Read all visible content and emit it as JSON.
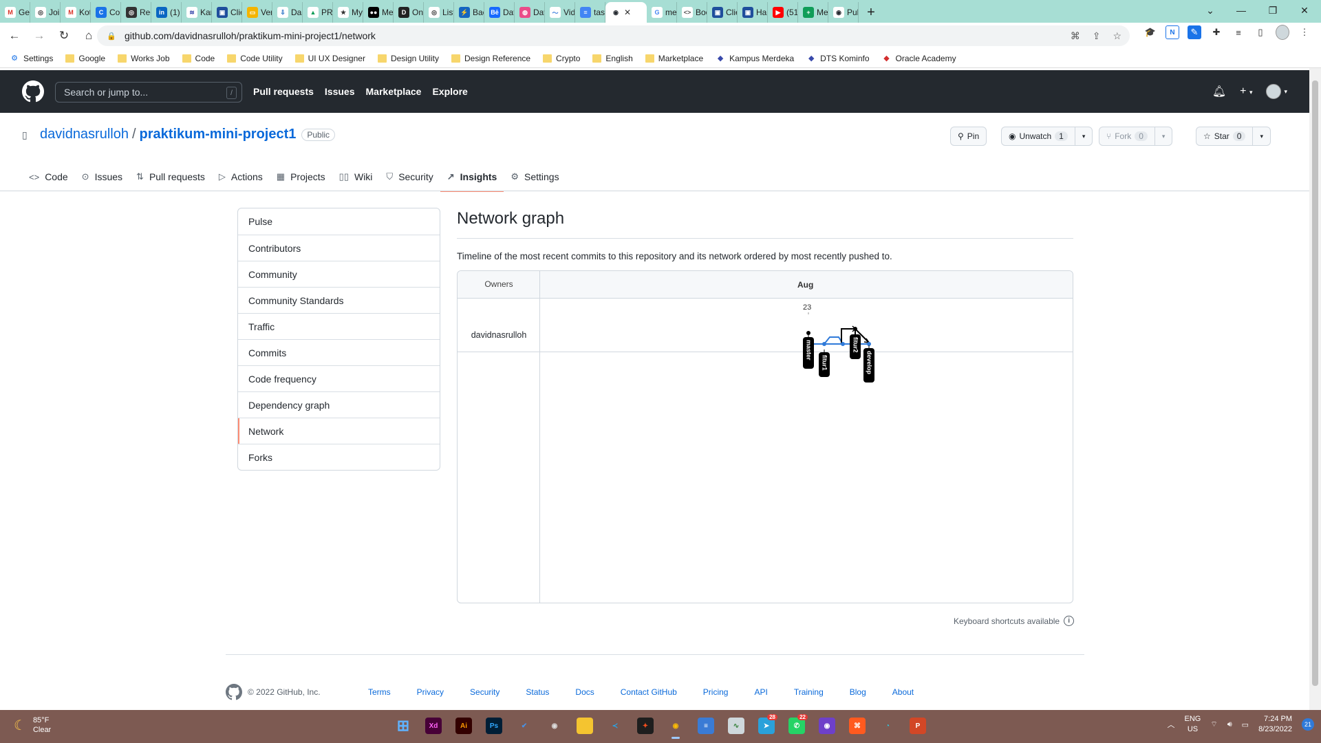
{
  "browser": {
    "tabs": [
      {
        "label": "Get",
        "color": "#ffffff",
        "glyph": "M",
        "glyph_color": "#d93025"
      },
      {
        "label": "Join",
        "color": "#ffffff",
        "glyph": "◎",
        "glyph_color": "#333333"
      },
      {
        "label": "Kot",
        "color": "#ffffff",
        "glyph": "M",
        "glyph_color": "#d93025"
      },
      {
        "label": "Cou",
        "color": "#1a73e8",
        "glyph": "C",
        "glyph_color": "#ffffff"
      },
      {
        "label": "Reg",
        "color": "#333333",
        "glyph": "◎",
        "glyph_color": "#ffffff"
      },
      {
        "label": "(1)",
        "color": "#0a66c2",
        "glyph": "in",
        "glyph_color": "#ffffff"
      },
      {
        "label": "Kar",
        "color": "#ffffff",
        "glyph": "≋",
        "glyph_color": "#3949ab"
      },
      {
        "label": "Clie",
        "color": "#1f4e9c",
        "glyph": "▣",
        "glyph_color": "#ffffff"
      },
      {
        "label": "Ver",
        "color": "#f4b400",
        "glyph": "▭",
        "glyph_color": "#ffffff"
      },
      {
        "label": "Das",
        "color": "#ffffff",
        "glyph": "⇩",
        "glyph_color": "#1565c0"
      },
      {
        "label": "PRC",
        "color": "#ffffff",
        "glyph": "▲",
        "glyph_color": "#0f9d58"
      },
      {
        "label": "My",
        "color": "#ffffff",
        "glyph": "★",
        "glyph_color": "#333333"
      },
      {
        "label": "Me",
        "color": "#000000",
        "glyph": "●●",
        "glyph_color": "#ffffff"
      },
      {
        "label": "Onl",
        "color": "#222222",
        "glyph": "D",
        "glyph_color": "#ffffff"
      },
      {
        "label": "List",
        "color": "#ffffff",
        "glyph": "◎",
        "glyph_color": "#333333"
      },
      {
        "label": "Bac",
        "color": "#1565c0",
        "glyph": "⚡",
        "glyph_color": "#ffffff"
      },
      {
        "label": "Dav",
        "color": "#1769ff",
        "glyph": "Bē",
        "glyph_color": "#ffffff"
      },
      {
        "label": "Dav",
        "color": "#ea4c89",
        "glyph": "◍",
        "glyph_color": "#ffffff"
      },
      {
        "label": "Vid",
        "color": "#ffffff",
        "glyph": "〜",
        "glyph_color": "#3b7ddd"
      },
      {
        "label": "tasl",
        "color": "#4285f4",
        "glyph": "≡",
        "glyph_color": "#ffffff"
      }
    ],
    "active_tab": {
      "label": "",
      "close": "✕"
    },
    "tabs_after": [
      {
        "label": "me",
        "color": "#ffffff",
        "glyph": "G",
        "glyph_color": "#4285f4"
      },
      {
        "label": "Boo",
        "color": "#ffffff",
        "glyph": "<>",
        "glyph_color": "#555555"
      },
      {
        "label": "Clie",
        "color": "#1f4e9c",
        "glyph": "▣",
        "glyph_color": "#ffffff"
      },
      {
        "label": "Hai",
        "color": "#1f4e9c",
        "glyph": "▣",
        "glyph_color": "#ffffff"
      },
      {
        "label": "(51",
        "color": "#ff0000",
        "glyph": "▶",
        "glyph_color": "#ffffff"
      },
      {
        "label": "Me",
        "color": "#0f9d58",
        "glyph": "+",
        "glyph_color": "#ffffff"
      },
      {
        "label": "Pul",
        "color": "#ffffff",
        "glyph": "◉",
        "glyph_color": "#24292f"
      }
    ],
    "url": "github.com/davidnasrulloh/praktikum-mini-project1/network",
    "bookmarks": [
      {
        "label": "Settings",
        "type": "gear"
      },
      {
        "label": "Google",
        "type": "folder"
      },
      {
        "label": "Works Job",
        "type": "folder"
      },
      {
        "label": "Code",
        "type": "folder"
      },
      {
        "label": "Code Utility",
        "type": "folder"
      },
      {
        "label": "UI UX Designer",
        "type": "folder"
      },
      {
        "label": "Design Utility",
        "type": "folder"
      },
      {
        "label": "Design Reference",
        "type": "folder"
      },
      {
        "label": "Crypto",
        "type": "folder"
      },
      {
        "label": "English",
        "type": "folder"
      },
      {
        "label": "Marketplace",
        "type": "folder"
      },
      {
        "label": "Kampus Merdeka",
        "type": "site"
      },
      {
        "label": "DTS Kominfo",
        "type": "site"
      },
      {
        "label": "Oracle Academy",
        "type": "site"
      }
    ]
  },
  "github": {
    "search_placeholder": "Search or jump to...",
    "search_shortcut": "/",
    "nav": [
      "Pull requests",
      "Issues",
      "Marketplace",
      "Explore"
    ]
  },
  "repo": {
    "owner": "davidnasrulloh",
    "separator": "/",
    "name": "praktikum-mini-project1",
    "visibility": "Public",
    "pin_label": "Pin",
    "unwatch_label": "Unwatch",
    "unwatch_count": "1",
    "fork_label": "Fork",
    "fork_count": "0",
    "star_label": "Star",
    "star_count": "0",
    "tabs": [
      {
        "label": "Code",
        "icon": "code-icon",
        "glyph": "<>"
      },
      {
        "label": "Issues",
        "icon": "issue-icon",
        "glyph": "⊙"
      },
      {
        "label": "Pull requests",
        "icon": "pull-request-icon",
        "glyph": "⇅"
      },
      {
        "label": "Actions",
        "icon": "play-icon",
        "glyph": "▷"
      },
      {
        "label": "Projects",
        "icon": "table-icon",
        "glyph": "▦"
      },
      {
        "label": "Wiki",
        "icon": "book-icon",
        "glyph": "▯▯"
      },
      {
        "label": "Security",
        "icon": "shield-icon",
        "glyph": "⛉"
      },
      {
        "label": "Insights",
        "icon": "graph-icon",
        "glyph": "↗"
      },
      {
        "label": "Settings",
        "icon": "gear-icon",
        "glyph": "⚙"
      }
    ],
    "selected_tab": "Insights"
  },
  "sidebar": {
    "items": [
      "Pulse",
      "Contributors",
      "Community",
      "Community Standards",
      "Traffic",
      "Commits",
      "Code frequency",
      "Dependency graph",
      "Network",
      "Forks"
    ],
    "selected": "Network"
  },
  "main": {
    "title": "Network graph",
    "description": "Timeline of the most recent commits to this repository and its network ordered by most recently pushed to.",
    "network": {
      "owners_header": "Owners",
      "month": "Aug",
      "day": "23",
      "owner": "davidnasrulloh",
      "branches": [
        "master",
        "fitur1",
        "fitur2",
        "develop"
      ],
      "line_color": "#2f7ad9",
      "label_bg": "#000000"
    },
    "keyboard_hint": "Keyboard shortcuts available"
  },
  "footer": {
    "copyright": "© 2022 GitHub, Inc.",
    "links": [
      "Terms",
      "Privacy",
      "Security",
      "Status",
      "Docs",
      "Contact GitHub",
      "Pricing",
      "API",
      "Training",
      "Blog",
      "About"
    ]
  },
  "taskbar": {
    "weather_temp": "85°F",
    "weather_cond": "Clear",
    "apps": [
      {
        "name": "windows-start-icon",
        "glyph": "⊞",
        "bg": "transparent",
        "fg": "#5fb3ff"
      },
      {
        "name": "adobe-xd-icon",
        "glyph": "Xd",
        "bg": "#470137",
        "fg": "#ff61f6"
      },
      {
        "name": "adobe-illustrator-icon",
        "glyph": "Ai",
        "bg": "#330000",
        "fg": "#ff9a00"
      },
      {
        "name": "adobe-photoshop-icon",
        "glyph": "Ps",
        "bg": "#001e36",
        "fg": "#31a8ff"
      },
      {
        "name": "todo-icon",
        "glyph": "✔",
        "bg": "transparent",
        "fg": "#4a90e2"
      },
      {
        "name": "obs-icon",
        "glyph": "◉",
        "bg": "transparent",
        "fg": "#dddddd"
      },
      {
        "name": "file-explorer-icon",
        "glyph": "▬",
        "bg": "#f4c430",
        "fg": "#f4c430"
      },
      {
        "name": "vscode-icon",
        "glyph": "≺",
        "bg": "transparent",
        "fg": "#23a9f2"
      },
      {
        "name": "figma-icon",
        "glyph": "✦",
        "bg": "#1e1e1e",
        "fg": "#f24e1e"
      },
      {
        "name": "chrome-icon",
        "glyph": "◉",
        "bg": "transparent",
        "fg": "#fbbc05"
      },
      {
        "name": "notepad-icon",
        "glyph": "≡",
        "bg": "#3a7bd5",
        "fg": "#ffffff"
      },
      {
        "name": "task-manager-icon",
        "glyph": "∿",
        "bg": "#cfd8dc",
        "fg": "#2e7d32"
      },
      {
        "name": "telegram-icon",
        "glyph": "➤",
        "bg": "#2aa1da",
        "fg": "#ffffff",
        "badge": "28"
      },
      {
        "name": "whatsapp-icon",
        "glyph": "✆",
        "bg": "#25d366",
        "fg": "#ffffff",
        "badge": "22"
      },
      {
        "name": "github-desktop-icon",
        "glyph": "◉",
        "bg": "#6e40c9",
        "fg": "#ffffff"
      },
      {
        "name": "acrobat-icon",
        "glyph": "⌘",
        "bg": "#ff5a1f",
        "fg": "#ffffff"
      },
      {
        "name": "edge-icon",
        "glyph": "◔",
        "bg": "transparent",
        "fg": "#2ccce4"
      },
      {
        "name": "powerpoint-icon",
        "glyph": "P",
        "bg": "#d24726",
        "fg": "#ffffff"
      }
    ],
    "lang": "ENG",
    "region": "US",
    "time": "7:24 PM",
    "date": "8/23/2022",
    "notifications": "21"
  }
}
